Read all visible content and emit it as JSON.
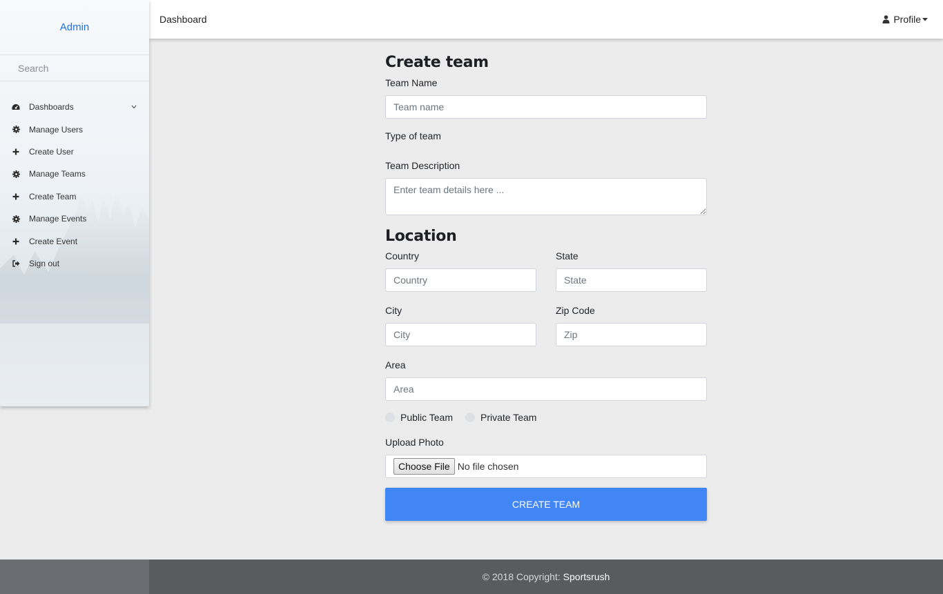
{
  "sidebar": {
    "brand": "Admin",
    "search_placeholder": "Search",
    "items": [
      {
        "label": "Dashboards",
        "icon": "dashboard-icon"
      },
      {
        "label": "Manage Users",
        "icon": "gear-icon"
      },
      {
        "label": "Create User",
        "icon": "plus-icon"
      },
      {
        "label": "Manage Teams",
        "icon": "gear-icon"
      },
      {
        "label": "Create Team",
        "icon": "plus-icon"
      },
      {
        "label": "Manage Events",
        "icon": "gear-icon"
      },
      {
        "label": "Create Event",
        "icon": "plus-icon"
      },
      {
        "label": "Sign out",
        "icon": "sign-out-icon"
      }
    ]
  },
  "topbar": {
    "breadcrumb": "Dashboard",
    "profile_label": "Profile",
    "profile_icon": "user-icon"
  },
  "form": {
    "title": "Create team",
    "team_name_label": "Team Name",
    "team_name_placeholder": "Team name",
    "type_label": "Type of team",
    "description_label": "Team Description",
    "description_placeholder": "Enter team details here ...",
    "location_title": "Location",
    "country_label": "Country",
    "country_placeholder": "Country",
    "state_label": "State",
    "state_placeholder": "State",
    "city_label": "City",
    "city_placeholder": "City",
    "zip_label": "Zip Code",
    "zip_placeholder": "Zip",
    "area_label": "Area",
    "area_placeholder": "Area",
    "visibility_options": [
      "Public Team",
      "Private Team"
    ],
    "upload_label": "Upload Photo",
    "choose_file_label": "Choose File",
    "no_file_text": "No file chosen",
    "submit_label": "CREATE TEAM"
  },
  "footer": {
    "copyright": "© 2018 Copyright:",
    "brand": "Sportsrush"
  },
  "colors": {
    "accent": "#4285f4",
    "brand_link": "#1a73e8",
    "background": "#ececec",
    "footer": "#5a5b5f"
  }
}
